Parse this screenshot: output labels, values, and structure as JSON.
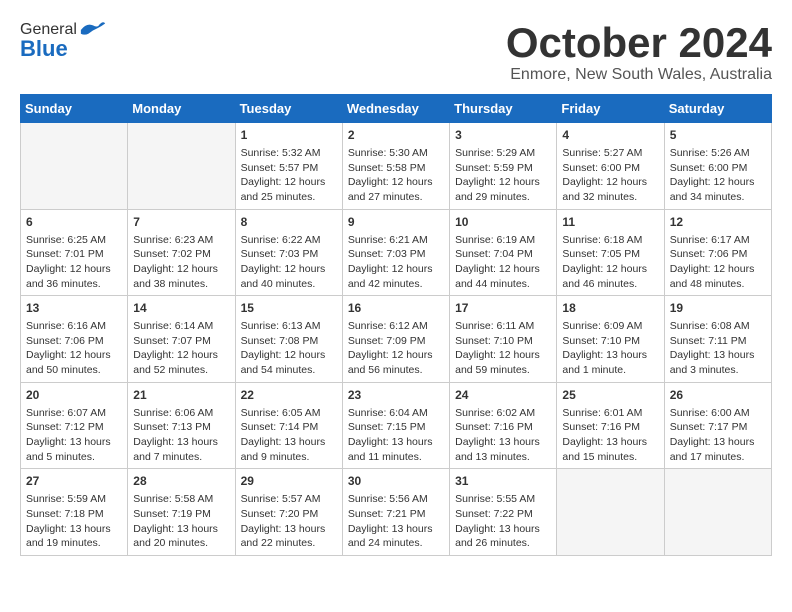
{
  "logo": {
    "general": "General",
    "blue": "Blue"
  },
  "title": "October 2024",
  "location": "Enmore, New South Wales, Australia",
  "headers": [
    "Sunday",
    "Monday",
    "Tuesday",
    "Wednesday",
    "Thursday",
    "Friday",
    "Saturday"
  ],
  "weeks": [
    [
      {
        "day": "",
        "info": ""
      },
      {
        "day": "",
        "info": ""
      },
      {
        "day": "1",
        "info": "Sunrise: 5:32 AM\nSunset: 5:57 PM\nDaylight: 12 hours\nand 25 minutes."
      },
      {
        "day": "2",
        "info": "Sunrise: 5:30 AM\nSunset: 5:58 PM\nDaylight: 12 hours\nand 27 minutes."
      },
      {
        "day": "3",
        "info": "Sunrise: 5:29 AM\nSunset: 5:59 PM\nDaylight: 12 hours\nand 29 minutes."
      },
      {
        "day": "4",
        "info": "Sunrise: 5:27 AM\nSunset: 6:00 PM\nDaylight: 12 hours\nand 32 minutes."
      },
      {
        "day": "5",
        "info": "Sunrise: 5:26 AM\nSunset: 6:00 PM\nDaylight: 12 hours\nand 34 minutes."
      }
    ],
    [
      {
        "day": "6",
        "info": "Sunrise: 6:25 AM\nSunset: 7:01 PM\nDaylight: 12 hours\nand 36 minutes."
      },
      {
        "day": "7",
        "info": "Sunrise: 6:23 AM\nSunset: 7:02 PM\nDaylight: 12 hours\nand 38 minutes."
      },
      {
        "day": "8",
        "info": "Sunrise: 6:22 AM\nSunset: 7:03 PM\nDaylight: 12 hours\nand 40 minutes."
      },
      {
        "day": "9",
        "info": "Sunrise: 6:21 AM\nSunset: 7:03 PM\nDaylight: 12 hours\nand 42 minutes."
      },
      {
        "day": "10",
        "info": "Sunrise: 6:19 AM\nSunset: 7:04 PM\nDaylight: 12 hours\nand 44 minutes."
      },
      {
        "day": "11",
        "info": "Sunrise: 6:18 AM\nSunset: 7:05 PM\nDaylight: 12 hours\nand 46 minutes."
      },
      {
        "day": "12",
        "info": "Sunrise: 6:17 AM\nSunset: 7:06 PM\nDaylight: 12 hours\nand 48 minutes."
      }
    ],
    [
      {
        "day": "13",
        "info": "Sunrise: 6:16 AM\nSunset: 7:06 PM\nDaylight: 12 hours\nand 50 minutes."
      },
      {
        "day": "14",
        "info": "Sunrise: 6:14 AM\nSunset: 7:07 PM\nDaylight: 12 hours\nand 52 minutes."
      },
      {
        "day": "15",
        "info": "Sunrise: 6:13 AM\nSunset: 7:08 PM\nDaylight: 12 hours\nand 54 minutes."
      },
      {
        "day": "16",
        "info": "Sunrise: 6:12 AM\nSunset: 7:09 PM\nDaylight: 12 hours\nand 56 minutes."
      },
      {
        "day": "17",
        "info": "Sunrise: 6:11 AM\nSunset: 7:10 PM\nDaylight: 12 hours\nand 59 minutes."
      },
      {
        "day": "18",
        "info": "Sunrise: 6:09 AM\nSunset: 7:10 PM\nDaylight: 13 hours\nand 1 minute."
      },
      {
        "day": "19",
        "info": "Sunrise: 6:08 AM\nSunset: 7:11 PM\nDaylight: 13 hours\nand 3 minutes."
      }
    ],
    [
      {
        "day": "20",
        "info": "Sunrise: 6:07 AM\nSunset: 7:12 PM\nDaylight: 13 hours\nand 5 minutes."
      },
      {
        "day": "21",
        "info": "Sunrise: 6:06 AM\nSunset: 7:13 PM\nDaylight: 13 hours\nand 7 minutes."
      },
      {
        "day": "22",
        "info": "Sunrise: 6:05 AM\nSunset: 7:14 PM\nDaylight: 13 hours\nand 9 minutes."
      },
      {
        "day": "23",
        "info": "Sunrise: 6:04 AM\nSunset: 7:15 PM\nDaylight: 13 hours\nand 11 minutes."
      },
      {
        "day": "24",
        "info": "Sunrise: 6:02 AM\nSunset: 7:16 PM\nDaylight: 13 hours\nand 13 minutes."
      },
      {
        "day": "25",
        "info": "Sunrise: 6:01 AM\nSunset: 7:16 PM\nDaylight: 13 hours\nand 15 minutes."
      },
      {
        "day": "26",
        "info": "Sunrise: 6:00 AM\nSunset: 7:17 PM\nDaylight: 13 hours\nand 17 minutes."
      }
    ],
    [
      {
        "day": "27",
        "info": "Sunrise: 5:59 AM\nSunset: 7:18 PM\nDaylight: 13 hours\nand 19 minutes."
      },
      {
        "day": "28",
        "info": "Sunrise: 5:58 AM\nSunset: 7:19 PM\nDaylight: 13 hours\nand 20 minutes."
      },
      {
        "day": "29",
        "info": "Sunrise: 5:57 AM\nSunset: 7:20 PM\nDaylight: 13 hours\nand 22 minutes."
      },
      {
        "day": "30",
        "info": "Sunrise: 5:56 AM\nSunset: 7:21 PM\nDaylight: 13 hours\nand 24 minutes."
      },
      {
        "day": "31",
        "info": "Sunrise: 5:55 AM\nSunset: 7:22 PM\nDaylight: 13 hours\nand 26 minutes."
      },
      {
        "day": "",
        "info": ""
      },
      {
        "day": "",
        "info": ""
      }
    ]
  ]
}
